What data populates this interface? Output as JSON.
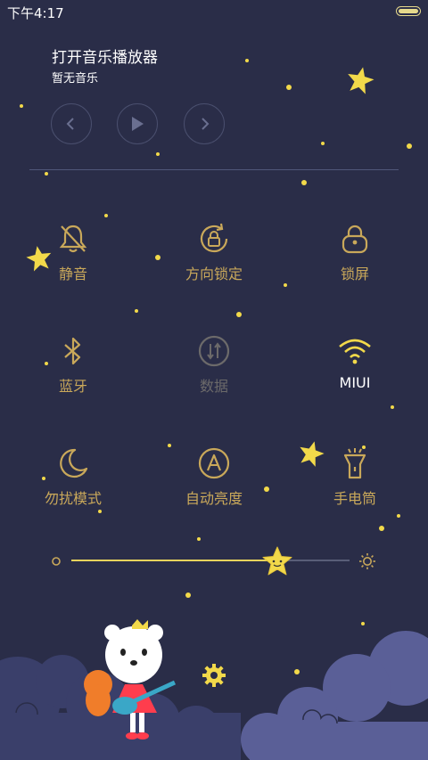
{
  "status_bar": {
    "time": "下午4:17",
    "battery_icon": "battery-icon"
  },
  "music": {
    "title": "打开音乐播放器",
    "subtitle": "暂无音乐",
    "controls": [
      "previous-icon",
      "play-icon",
      "next-icon"
    ]
  },
  "toggles": [
    {
      "label": "静音",
      "icon": "bell-off-icon",
      "state": "off"
    },
    {
      "label": "方向锁定",
      "icon": "rotation-lock-icon",
      "state": "off"
    },
    {
      "label": "锁屏",
      "icon": "lock-icon",
      "state": "off"
    },
    {
      "label": "蓝牙",
      "icon": "bluetooth-icon",
      "state": "off"
    },
    {
      "label": "数据",
      "icon": "data-arrows-icon",
      "state": "disabled"
    },
    {
      "label": "MIUI",
      "icon": "wifi-icon",
      "state": "on"
    },
    {
      "label": "勿扰模式",
      "icon": "moon-icon",
      "state": "off"
    },
    {
      "label": "自动亮度",
      "icon": "auto-brightness-icon",
      "state": "off"
    },
    {
      "label": "手电筒",
      "icon": "flashlight-icon",
      "state": "off"
    }
  ],
  "brightness": {
    "level": 0.74,
    "min_icon": "brightness-low-icon",
    "max_icon": "brightness-high-icon"
  },
  "colors": {
    "background": "#2a2d48",
    "accent": "#c9a85a",
    "slider": "#e8d35c",
    "cloud": "#5a5f97"
  },
  "settings_icon": "gear-icon"
}
